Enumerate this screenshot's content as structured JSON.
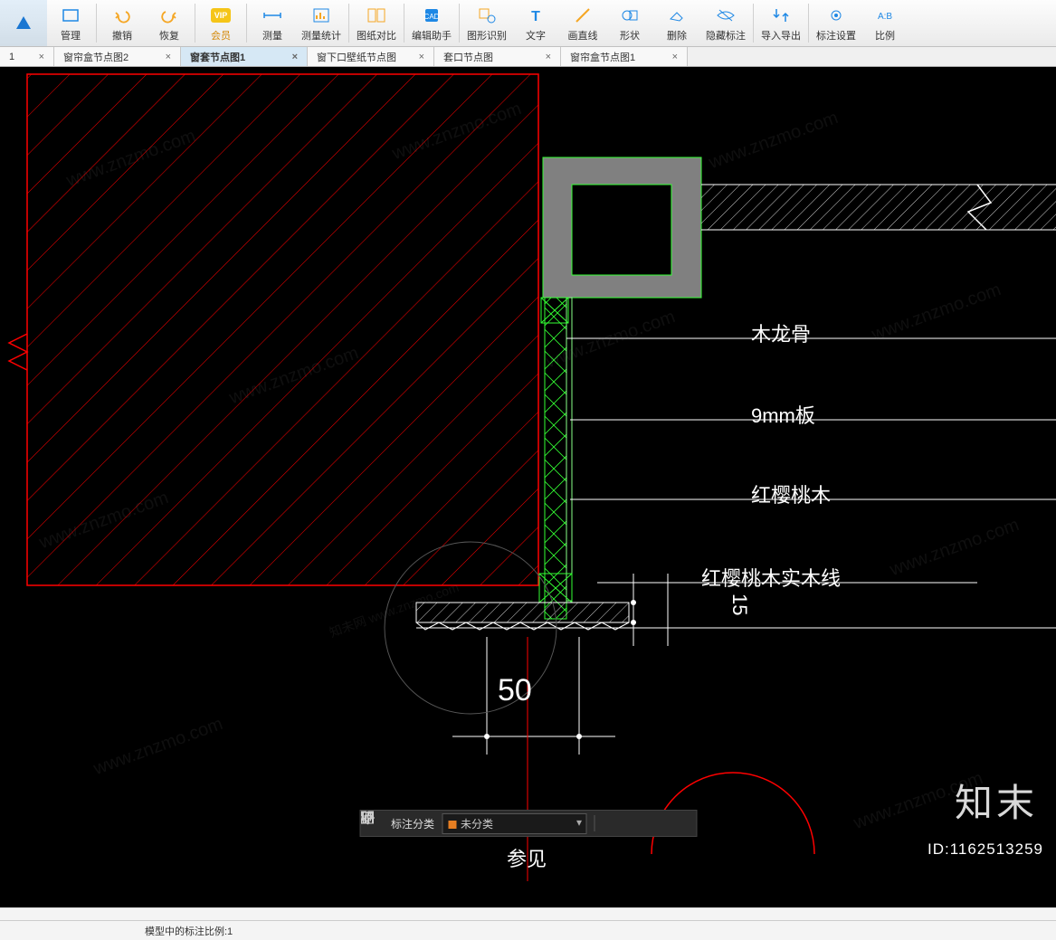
{
  "toolbar": {
    "items": [
      {
        "label": "管理",
        "icon": "manage"
      },
      {
        "label": "撤销",
        "icon": "undo"
      },
      {
        "label": "恢复",
        "icon": "redo"
      },
      {
        "label": "会员",
        "icon": "vip"
      },
      {
        "label": "测量",
        "icon": "measure"
      },
      {
        "label": "测量统计",
        "icon": "measure-stats"
      },
      {
        "label": "图纸对比",
        "icon": "compare"
      },
      {
        "label": "编辑助手",
        "icon": "edit-assist"
      },
      {
        "label": "图形识别",
        "icon": "shape-recog"
      },
      {
        "label": "文字",
        "icon": "text"
      },
      {
        "label": "画直线",
        "icon": "line"
      },
      {
        "label": "形状",
        "icon": "shape"
      },
      {
        "label": "删除",
        "icon": "delete"
      },
      {
        "label": "隐藏标注",
        "icon": "hide"
      },
      {
        "label": "导入导出",
        "icon": "import-export"
      },
      {
        "label": "标注设置",
        "icon": "anno-settings"
      },
      {
        "label": "比例",
        "icon": "scale"
      }
    ]
  },
  "tabs": [
    {
      "label": "1",
      "active": false,
      "partial": true
    },
    {
      "label": "窗帘盒节点图2",
      "active": false
    },
    {
      "label": "窗套节点图1",
      "active": true
    },
    {
      "label": "窗下口壁纸节点图",
      "active": false
    },
    {
      "label": "套口节点图",
      "active": false
    },
    {
      "label": "窗帘盒节点图1",
      "active": false
    }
  ],
  "drawing": {
    "labels": {
      "l1": "木龙骨",
      "l2": "9mm板",
      "l3": "红樱桃木",
      "l4": "红樱桃木实木线",
      "d1": "50",
      "d2": "15",
      "ref": "参见"
    }
  },
  "bottom_toolbar": {
    "category_label": "标注分类",
    "category_value": "未分类"
  },
  "brand": "知末",
  "id_label": "ID:",
  "id_value": "1162513259",
  "status": "模型中的标注比例:1",
  "watermark": "www.znzmo.com",
  "watermark2": "知未网 www.znzmo.com"
}
